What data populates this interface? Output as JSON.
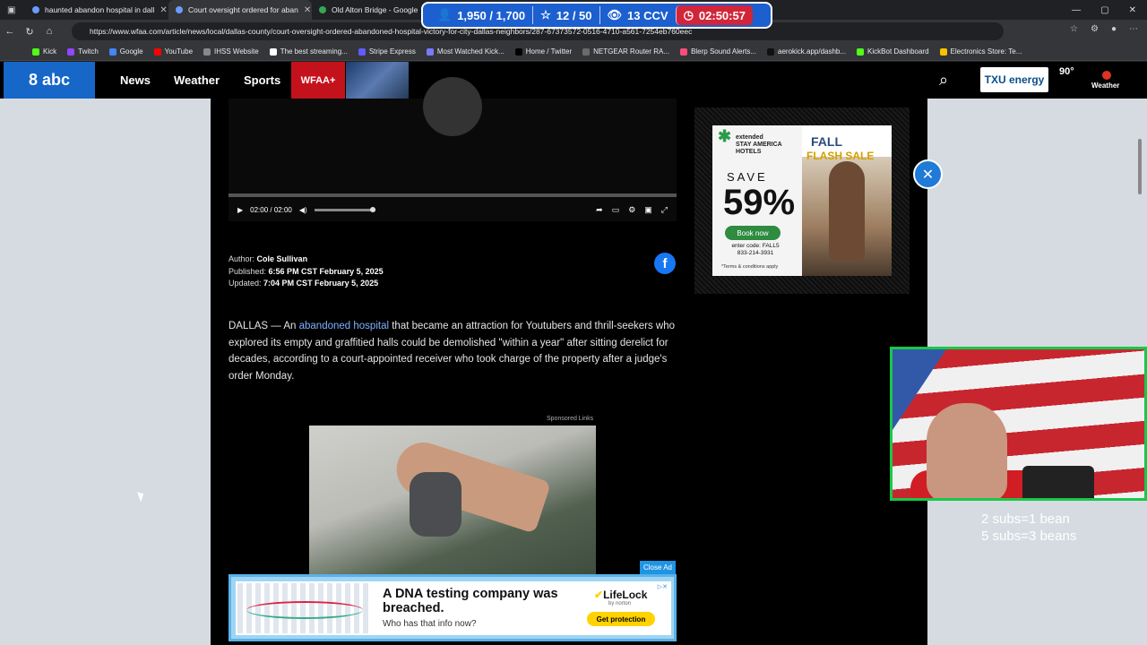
{
  "tabs": [
    {
      "title": "haunted abandon hospital in dall",
      "close": "✕"
    },
    {
      "title": "Court oversight ordered for aban",
      "close": "✕"
    },
    {
      "title": "Old Alton Bridge - Google M",
      "close": ""
    }
  ],
  "window_controls": [
    "—",
    "▢",
    "✕"
  ],
  "stream_stats": {
    "followers": "1,950 / 1,700",
    "subs": "12 / 50",
    "ccv": "13 CCV",
    "timer": "02:50:57"
  },
  "address": {
    "url": "https://www.wfaa.com/article/news/local/dallas-county/court-oversight-ordered-abandoned-hospital-victory-for-city-dallas-neighbors/287-67373572-0516-4710-a561-7254eb760eec"
  },
  "bookmarks": [
    {
      "label": "Kick",
      "color": "#53fc18"
    },
    {
      "label": "Twitch",
      "color": "#9146ff"
    },
    {
      "label": "Google",
      "color": "#4285f4"
    },
    {
      "label": "YouTube",
      "color": "#ff0000"
    },
    {
      "label": "IHSS Website",
      "color": "#888888"
    },
    {
      "label": "The best streaming...",
      "color": "#ffffff"
    },
    {
      "label": "Stripe Express",
      "color": "#635bff"
    },
    {
      "label": "Most Watched Kick...",
      "color": "#7a7aff"
    },
    {
      "label": "Home / Twitter",
      "color": "#000000"
    },
    {
      "label": "NETGEAR Router RA...",
      "color": "#6b6b6b"
    },
    {
      "label": "Blerp Sound Alerts...",
      "color": "#ff4d7a"
    },
    {
      "label": "aerokick.app/dashb...",
      "color": "#111111"
    },
    {
      "label": "KickBot Dashboard",
      "color": "#53fc18"
    },
    {
      "label": "Electronics Store: Te...",
      "color": "#f5c400"
    }
  ],
  "site": {
    "logo": "8 abc",
    "nav": {
      "news": "News",
      "weather": "Weather",
      "sports": "Sports",
      "wfaa_plus": "WFAA+"
    },
    "txu": "TXU energy",
    "temp": "90°",
    "weather_link": "Weather"
  },
  "video": {
    "time": "02:00 / 02:00"
  },
  "article": {
    "author_label": "Author:",
    "author": "Cole Sullivan",
    "published_label": "Published:",
    "published": "6:56 PM CST February 5, 2025",
    "updated_label": "Updated:",
    "updated": "7:04 PM CST February 5, 2025",
    "p1_prefix": "DALLAS — An ",
    "p1_link": "abandoned hospital",
    "p1_rest": " that became an attraction for Youtubers and thrill-seekers who explored its empty and graffitied halls could be demolished \"within a year\" after sitting derelict for decades, according to a court-appointed receiver who took charge of the property after a judge's order Monday.",
    "sponsored": "Sponsored Links",
    "close_ad": "Close Ad"
  },
  "banner_ad": {
    "headline": "A DNA testing company was breached.",
    "sub": "Who has that info now?",
    "brand": "LifeLock",
    "brand_sub": "by norton",
    "cta": "Get protection"
  },
  "side_ad": {
    "brand_line1": "extended",
    "brand_line2": "STAY AMERICA",
    "brand_line3": "HOTELS",
    "fall": "FALL",
    "flash": "FLASH SALE",
    "save": "SAVE",
    "up_to": "UP TO",
    "percent": "59%",
    "book": "Book now",
    "code": "enter code: FALL5",
    "phone": "833-214-3931",
    "terms": "*Terms & conditions apply"
  },
  "overlay": {
    "caption_line1": "2 subs=1 bean",
    "caption_line2": "5 subs=3 beans"
  }
}
